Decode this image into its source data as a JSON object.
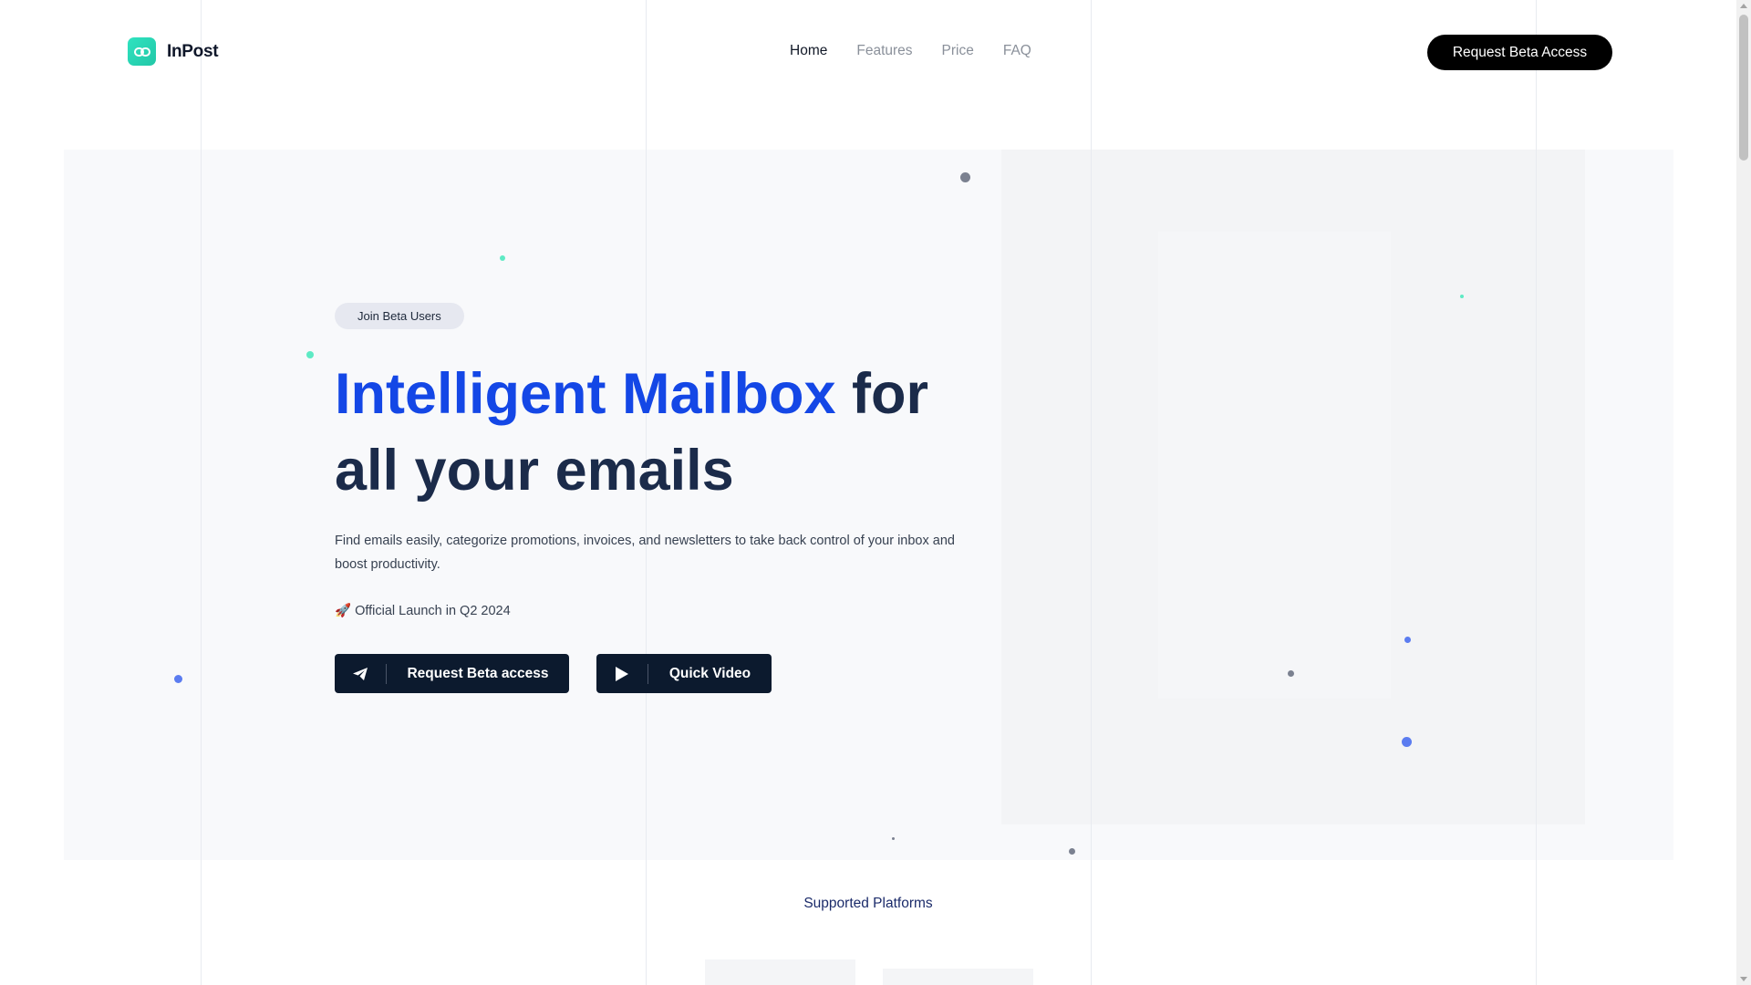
{
  "brand": {
    "name": "InPost",
    "icon": "link-icon",
    "color": "#2fe3c0"
  },
  "nav": {
    "items": [
      {
        "label": "Home",
        "active": true
      },
      {
        "label": "Features",
        "active": false
      },
      {
        "label": "Price",
        "active": false
      },
      {
        "label": "FAQ",
        "active": false
      }
    ],
    "cta_label": "Request Beta Access"
  },
  "hero": {
    "badge": "Join Beta Users",
    "headline_accent": "Intelligent Mailbox",
    "headline_rest": " for all your emails",
    "subtitle": "Find emails easily, categorize promotions, invoices, and newsletters to take back control of your inbox and boost productivity.",
    "launch_emoji": "🚀",
    "launch_text": "Official Launch in Q2 2024",
    "primary_button": {
      "label": "Request Beta access",
      "icon": "send-icon"
    },
    "secondary_button": {
      "label": "Quick Video",
      "icon": "play-icon"
    }
  },
  "platforms": {
    "title": "Supported Platforms"
  },
  "colors": {
    "accent": "#1447e6",
    "heading": "#1b2b4a",
    "button_dark": "#0c1a2e",
    "dot_teal": "#5eeac4",
    "dot_blue": "#5b7cf0",
    "dot_gray": "#7b8190"
  }
}
